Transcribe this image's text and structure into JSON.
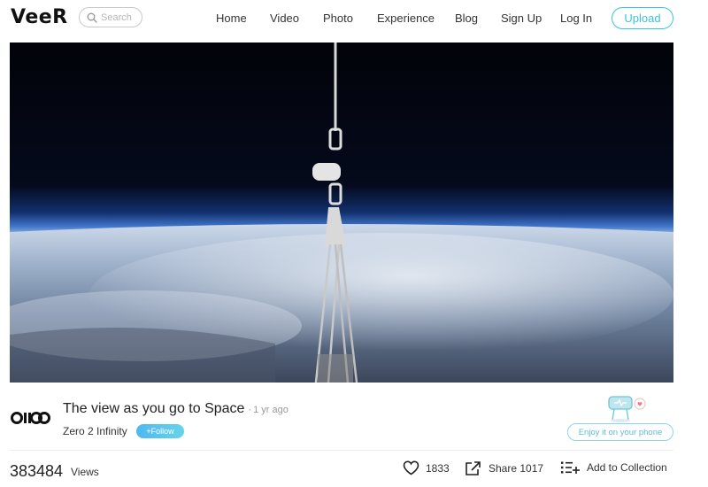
{
  "header": {
    "logo": "VeeR",
    "search_placeholder": "Search",
    "nav": [
      "Home",
      "Video",
      "Photo",
      "Experience",
      "Blog",
      "Sign Up",
      "Log In"
    ],
    "upload_label": "Upload",
    "accent_color": "#3cc3d8"
  },
  "video": {
    "title": "The view as you go to Space",
    "separator": "·",
    "time_ago": "1 yr ago",
    "channel_name": "Zero 2 Infinity",
    "channel_logo": "OIIOO",
    "follow_label": "+Follow",
    "enjoy_label": "Enjoy it on your phone"
  },
  "stats": {
    "views": "383484",
    "views_label": "Views",
    "likes": "1833",
    "share_label": "Share 1017",
    "collection_label": "Add to Collection"
  },
  "icons": [
    "search-icon",
    "heart-icon",
    "share-icon",
    "add-to-collection-icon"
  ]
}
